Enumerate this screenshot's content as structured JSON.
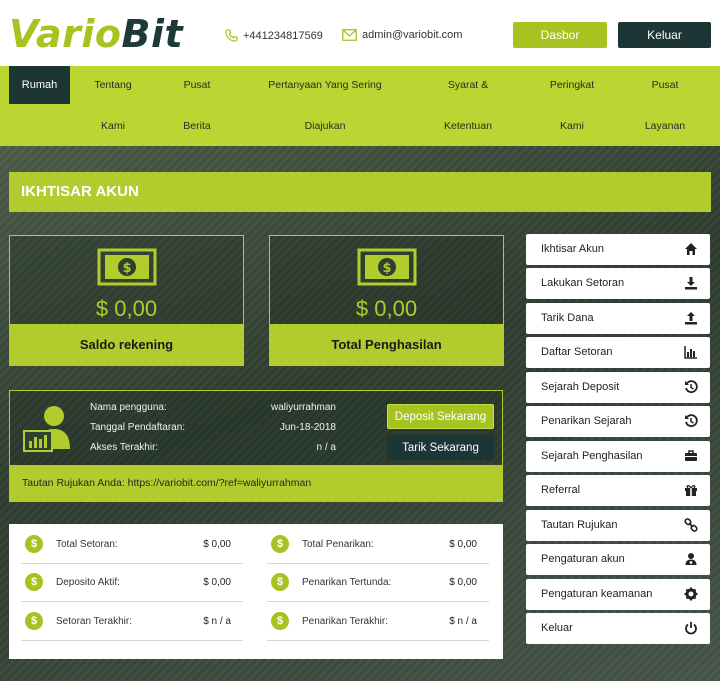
{
  "header": {
    "logo_part1": "Vario",
    "logo_part2": "Bit",
    "phone": "+441234817569",
    "email": "admin@variobit.com",
    "dashboard_button": "Dasbor",
    "logout_button": "Keluar"
  },
  "nav": {
    "active": "Rumah",
    "items": [
      {
        "line1": "Tentang",
        "line2": "Kami"
      },
      {
        "line1": "Pusat",
        "line2": "Berita"
      },
      {
        "line1": "Pertanyaan Yang Sering",
        "line2": "Diajukan"
      },
      {
        "line1": "Syarat &",
        "line2": "Ketentuan"
      },
      {
        "line1": "Peringkat",
        "line2": "Kami"
      },
      {
        "line1": "Pusat",
        "line2": "Layanan"
      }
    ]
  },
  "section_title": "IKHTISAR AKUN",
  "cards": [
    {
      "amount": "$ 0,00",
      "label": "Saldo rekening"
    },
    {
      "amount": "$ 0,00",
      "label": "Total Penghasilan"
    }
  ],
  "user": {
    "username_label": "Nama pengguna:",
    "username": "waliyurrahman",
    "registered_label": "Tanggal Pendaftaran:",
    "registered": "Jun-18-2018",
    "last_access_label": "Akses Terakhir:",
    "last_access": "n / a",
    "deposit_button": "Deposit Sekarang",
    "withdraw_button": "Tarik Sekarang",
    "referral_text": "Tautan Rujukan Anda: https://variobit.com/?ref=waliyurrahman"
  },
  "stats": {
    "left": [
      {
        "label": "Total Setoran:",
        "value": "$ 0,00"
      },
      {
        "label": "Deposito Aktif:",
        "value": "$ 0,00"
      },
      {
        "label": "Setoran Terakhir:",
        "value": "$ n / a"
      }
    ],
    "right": [
      {
        "label": "Total Penarikan:",
        "value": "$ 0,00"
      },
      {
        "label": "Penarikan Tertunda:",
        "value": "$ 0,00"
      },
      {
        "label": "Penarikan Terakhir:",
        "value": "$ n / a"
      }
    ],
    "coin_symbol": "$"
  },
  "sidebar": {
    "items": [
      {
        "label": "Ikhtisar Akun",
        "icon": "home-icon"
      },
      {
        "label": "Lakukan Setoran",
        "icon": "download-icon"
      },
      {
        "label": "Tarik Dana",
        "icon": "upload-icon"
      },
      {
        "label": "Daftar Setoran",
        "icon": "bar-chart-icon"
      },
      {
        "label": "Sejarah Deposit",
        "icon": "history-icon"
      },
      {
        "label": "Penarikan Sejarah",
        "icon": "history-icon"
      },
      {
        "label": "Sejarah Penghasilan",
        "icon": "briefcase-icon"
      },
      {
        "label": "Referral",
        "icon": "gift-icon"
      },
      {
        "label": "Tautan Rujukan",
        "icon": "link-icon"
      },
      {
        "label": "Pengaturan akun",
        "icon": "user-settings-icon"
      },
      {
        "label": "Pengaturan keamanan",
        "icon": "gear-icon"
      },
      {
        "label": "Keluar",
        "icon": "power-icon"
      }
    ]
  },
  "colors": {
    "accent": "#a6c31f",
    "nav": "#bbd632",
    "dark": "#1c3535"
  }
}
